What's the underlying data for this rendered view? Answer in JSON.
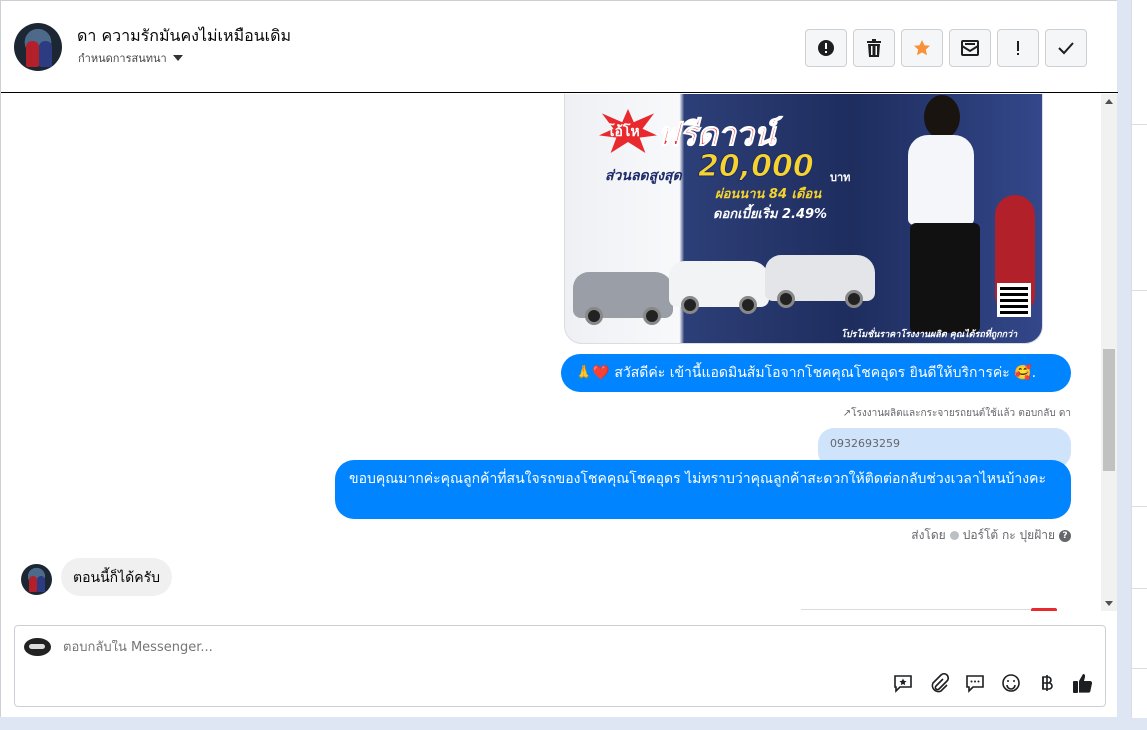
{
  "header": {
    "name": "ดา ความรักมันคงไม่เหมือนเดิม",
    "subtitle": "กำหนดการสนทนา"
  },
  "toolbar": {
    "buttons": [
      {
        "icon": "alert-circle-icon"
      },
      {
        "icon": "trash-icon"
      },
      {
        "icon": "star-icon",
        "color": "#f7923a"
      },
      {
        "icon": "mark-unread-icon"
      },
      {
        "icon": "exclamation-icon"
      },
      {
        "icon": "checkmark-icon"
      }
    ]
  },
  "ad_image": {
    "badge": "โอ้โห",
    "headline": "ฟรีดาวน์",
    "discount_label": "ส่วนลดสูงสุด",
    "amount": "20,000",
    "currency": "บาท",
    "installment": "ผ่อนนาน 84 เดือน",
    "interest": "ดอกเบี้ยเริ่ม 2.49%",
    "fineprint": "โปรโมชั่นราคาโรงงานผลิต คุณได้รถที่ถูกกว่า"
  },
  "messages": {
    "greeting": "🙏❤️ สวัสดีค่ะ เข้านี้แอดมินส้มโอจากโชคคุณโชคอุดร ยินดีให้บริการค่ะ 🥰.",
    "reply_note": "↗โรงงานผลิตและกระจายรถยนต์ใช้แล้ว ตอบกลับ ดา",
    "quoted_text": "0932693259",
    "reply": "ขอบคุณมากค่ะคุณลูกค้าที่สนใจรถของโชคคุณโชคอุดร ไม่ทราบว่าคุณลูกค้าสะดวกให้ติดต่อกลับช่วงเวลาไหนบ้างคะ",
    "sent_by_prefix": "ส่งโดย",
    "sent_by_name": "ปอร์โต้ กะ ปุยฝ้าย",
    "incoming": "ตอนนี้ก็ได้ครับ"
  },
  "composer": {
    "placeholder": "ตอบกลับใน Messenger...",
    "icons": [
      "saved-reply-icon",
      "attachment-icon",
      "message-icon",
      "emoji-icon",
      "baht-payment-icon",
      "thumbs-up-icon"
    ]
  },
  "colors": {
    "outgoing_bubble": "#0084ff",
    "incoming_bubble": "#f0f0f0",
    "quoted_bubble": "#cfe3fb"
  }
}
